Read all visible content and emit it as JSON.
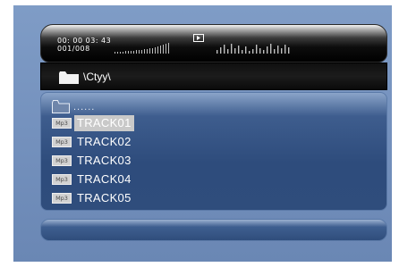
{
  "player": {
    "elapsed_time": "00: 00 03: 43",
    "track_position": "001/008",
    "play_state_icon": "play-icon"
  },
  "path": {
    "folder_icon": "folder-icon",
    "label": "\\Ctyy\\"
  },
  "file_list": {
    "parent_entry": "......",
    "tracks": [
      {
        "badge": "Mp3",
        "name": "TRACK01",
        "selected": true
      },
      {
        "badge": "Mp3",
        "name": "TRACK02",
        "selected": false
      },
      {
        "badge": "Mp3",
        "name": "TRACK03",
        "selected": false
      },
      {
        "badge": "Mp3",
        "name": "TRACK04",
        "selected": false
      },
      {
        "badge": "Mp3",
        "name": "TRACK05",
        "selected": false
      }
    ]
  },
  "colors": {
    "background": "#7491bd",
    "list_panel": "#2e4c7c",
    "selection": "#c9c9c9"
  }
}
